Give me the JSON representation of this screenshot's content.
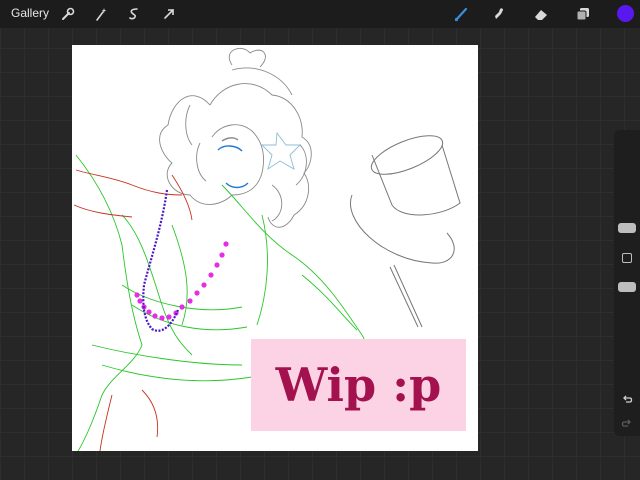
{
  "toolbar": {
    "gallery_label": "Gallery",
    "left_icons": [
      "wrench-icon",
      "magic-wand-icon",
      "selection-icon",
      "transform-arrow-icon"
    ],
    "right_icons": [
      "brush-icon",
      "smudge-icon",
      "eraser-icon",
      "layers-icon"
    ],
    "active_tool": "brush-icon",
    "active_tool_color": "#3a8dde",
    "current_color": "#5a18f0"
  },
  "canvas": {
    "background": "#ffffff",
    "overlay_text": "Wip :p",
    "overlay_bg": "#fcd3e4",
    "overlay_text_color": "#a3124f"
  },
  "sidebar": {
    "brush_size_level": 0.32,
    "opacity_level": 0.8,
    "icons": [
      "undo-icon",
      "redo-icon"
    ]
  }
}
